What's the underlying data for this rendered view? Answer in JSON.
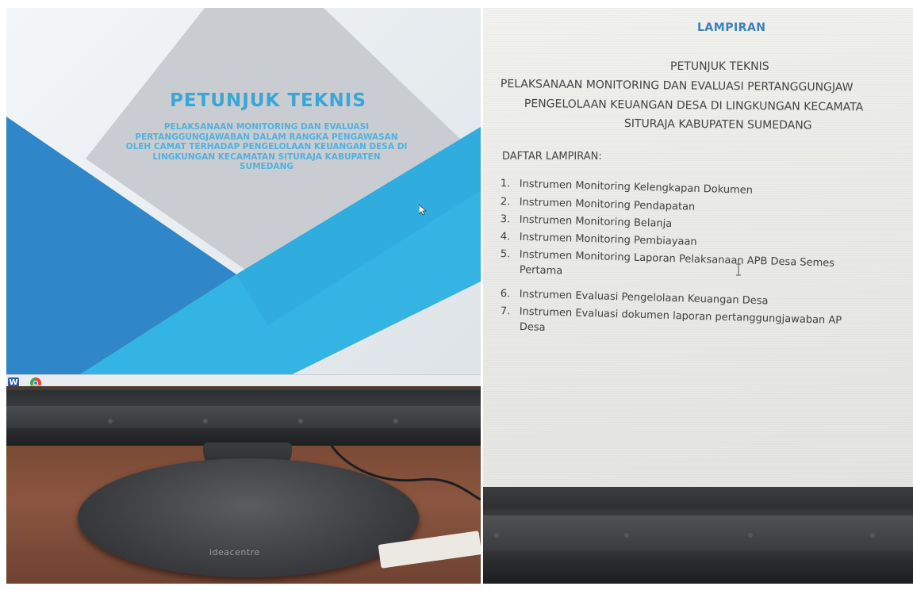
{
  "left_photo": {
    "slide": {
      "title": "PETUNJUK TEKNIS",
      "subtitle_lines": [
        "PELAKSANAAN MONITORING DAN EVALUASI",
        "PERTANGGUNGJAWABAN DALAM RANGKA PENGAWASAN",
        "OLEH CAMAT TERHADAP PENGELOLAAN KEUANGAN DESA DI",
        "LINGKUNGAN KECAMATAN SITURAJA KABUPATEN",
        "SUMEDANG"
      ]
    },
    "taskbar": {
      "icons": [
        "word-icon",
        "chrome-icon"
      ]
    },
    "stand_brand": "ideacentre",
    "colors": {
      "accent_blue": "#3aa6d8",
      "slide_gray": "#c9cdd1",
      "dark_blue": "#2f86c9"
    }
  },
  "right_photo": {
    "document": {
      "header": "LAMPIRAN",
      "title": "PETUNJUK TEKNIS",
      "title_lines": [
        "PELAKSANAAN MONITORING DAN EVALUASI PERTANGGUNGJAW",
        "PENGELOLAAN KEUANGAN DESA DI LINGKUNGAN KECAMATA",
        "SITURAJA KABUPATEN SUMEDANG"
      ],
      "list_heading": "DAFTAR LAMPIRAN:",
      "items": [
        {
          "num": "1.",
          "text": "Instrumen Monitoring Kelengkapan Dokumen"
        },
        {
          "num": "2.",
          "text": "Instrumen Monitoring Pendapatan"
        },
        {
          "num": "3.",
          "text": "Instrumen Monitoring Belanja"
        },
        {
          "num": "4.",
          "text": "Instrumen Monitoring Pembiayaan"
        },
        {
          "num": "5.",
          "text": "Instrumen   Monitoring   Laporan  Pelaksanaan  APB  Desa  Semes",
          "cont": "Pertama"
        },
        {
          "num": "6.",
          "text": "Instrumen Evaluasi Pengelolaan Keuangan Desa"
        },
        {
          "num": "7.",
          "text": "Instrumen   Evaluasi  dokumen  laporan  pertanggungjawaban  AP",
          "cont": "Desa"
        }
      ]
    }
  }
}
